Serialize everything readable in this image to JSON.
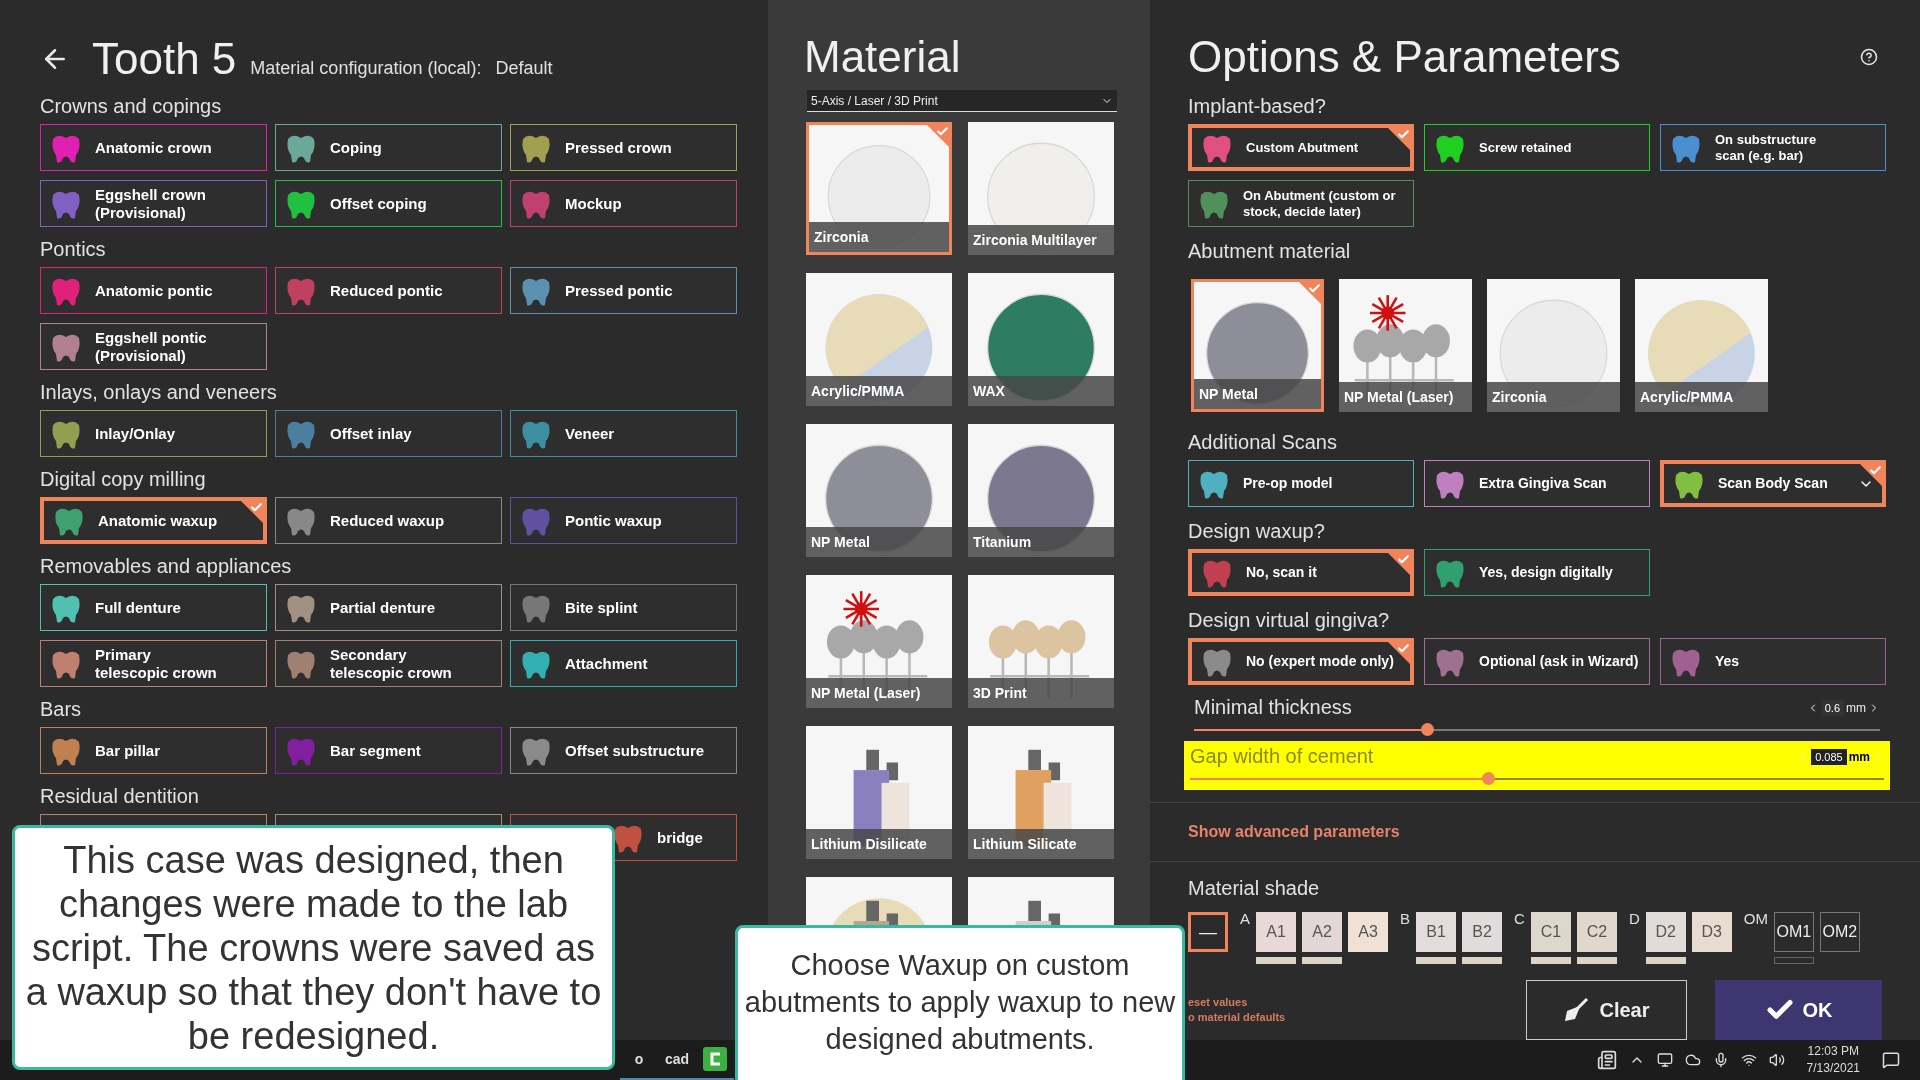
{
  "header": {
    "title": "Tooth 5",
    "config_label": "Material configuration (local):",
    "config_value": "Default"
  },
  "sections": [
    {
      "title": "Crowns and copings",
      "items": [
        {
          "label": "Anatomic crown",
          "color": "#e020b0",
          "selected": false
        },
        {
          "label": "Coping",
          "color": "#6aa89a",
          "selected": false
        },
        {
          "label": "Pressed crown",
          "color": "#a0a050",
          "selected": false
        },
        {
          "label": "Eggshell crown\n(Provisional)",
          "color": "#8060c0",
          "selected": false
        },
        {
          "label": "Offset coping",
          "color": "#20c040",
          "selected": false
        },
        {
          "label": "Mockup",
          "color": "#c04070",
          "selected": false
        }
      ]
    },
    {
      "title": "Pontics",
      "items": [
        {
          "label": "Anatomic pontic",
          "color": "#e0207a",
          "selected": false
        },
        {
          "label": "Reduced pontic",
          "color": "#c04060",
          "selected": false
        },
        {
          "label": "Pressed pontic",
          "color": "#5a90b0",
          "selected": false
        },
        {
          "label": "Eggshell pontic\n(Provisional)",
          "color": "#b08090",
          "selected": false
        }
      ]
    },
    {
      "title": "Inlays, onlays and veneers",
      "items": [
        {
          "label": "Inlay/Onlay",
          "color": "#90a050",
          "selected": false
        },
        {
          "label": "Offset inlay",
          "color": "#4a7fa0",
          "selected": false
        },
        {
          "label": "Veneer",
          "color": "#3a8fa0",
          "selected": false
        }
      ]
    },
    {
      "title": "Digital copy milling",
      "items": [
        {
          "label": "Anatomic waxup",
          "color": "#40a070",
          "selected": true
        },
        {
          "label": "Reduced waxup",
          "color": "#888888",
          "selected": false
        },
        {
          "label": "Pontic waxup",
          "color": "#6050a0",
          "selected": false
        }
      ]
    },
    {
      "title": "Removables and appliances",
      "items": [
        {
          "label": "Full denture",
          "color": "#50c0b0",
          "selected": false
        },
        {
          "label": "Partial denture",
          "color": "#a09080",
          "selected": false
        },
        {
          "label": "Bite splint",
          "color": "#777777",
          "selected": false
        },
        {
          "label": "Primary\ntelescopic crown",
          "color": "#c08070",
          "selected": false
        },
        {
          "label": "Secondary\ntelescopic crown",
          "color": "#a08070",
          "selected": false
        },
        {
          "label": "Attachment",
          "color": "#30b0b0",
          "selected": false
        }
      ]
    },
    {
      "title": "Bars",
      "items": [
        {
          "label": "Bar pillar",
          "color": "#c08050",
          "selected": false
        },
        {
          "label": "Bar segment",
          "color": "#8020a0",
          "selected": false
        },
        {
          "label": "Offset substructure",
          "color": "#8a8a8a",
          "selected": false
        }
      ]
    },
    {
      "title": "Residual dentition",
      "items": [
        {
          "color": "#c08060"
        },
        {
          "color": "#a09070"
        },
        {
          "label": "bridge",
          "color": "#c05040",
          "selected": false
        }
      ]
    }
  ],
  "material": {
    "title": "Material",
    "dropdown": "5-Axis / Laser / 3D Print",
    "tiles": [
      {
        "label": "Zirconia",
        "kind": "disc",
        "color": "#ececec",
        "selected": true
      },
      {
        "label": "Zirconia Multilayer",
        "kind": "disc",
        "color": "#f0efec",
        "selected": false
      },
      {
        "label": "Acrylic/PMMA",
        "kind": "split-disc",
        "color": "#e8dcb8",
        "selected": false
      },
      {
        "label": "WAX",
        "kind": "disc",
        "color": "#2e7d62",
        "selected": false
      },
      {
        "label": "NP Metal",
        "kind": "disc",
        "color": "#8e8e98",
        "selected": false
      },
      {
        "label": "Titanium",
        "kind": "disc",
        "color": "#7c7890",
        "selected": false
      },
      {
        "label": "NP Metal (Laser)",
        "kind": "laser-print",
        "color": "#a8a8a8",
        "selected": false
      },
      {
        "label": "3D Print",
        "kind": "print",
        "color": "#dcc4a0",
        "selected": false
      },
      {
        "label": "Lithium Disilicate",
        "kind": "block",
        "color": "#8a80c0",
        "selected": false
      },
      {
        "label": "Lithium Silicate",
        "kind": "block",
        "color": "#e0a060",
        "selected": false
      },
      {
        "kind": "block-disc",
        "selected": false
      },
      {
        "kind": "block",
        "selected": false
      }
    ]
  },
  "options": {
    "title": "Options & Parameters",
    "groups": [
      {
        "title": "Implant-based?",
        "items": [
          {
            "label": "Custom Abutment",
            "color": "#e05080",
            "selected": true
          },
          {
            "label": "Screw retained",
            "color": "#20d020",
            "selected": false
          },
          {
            "label": "On substructure\nscan (e.g. bar)",
            "color": "#4a90d0",
            "selected": false
          },
          {
            "label": "On Abutment (custom or\nstock, decide later)",
            "color": "#50905a",
            "selected": false
          }
        ]
      }
    ],
    "abutment": {
      "title": "Abutment material",
      "tiles": [
        {
          "label": "NP Metal",
          "kind": "disc",
          "color": "#8e8e98",
          "selected": true
        },
        {
          "label": "NP Metal (Laser)",
          "kind": "laser-print",
          "color": "#a8a8a8",
          "selected": false
        },
        {
          "label": "Zirconia",
          "kind": "disc",
          "color": "#ececec",
          "selected": false
        },
        {
          "label": "Acrylic/PMMA",
          "kind": "split-disc",
          "color": "#e8dcb8",
          "selected": false
        }
      ]
    },
    "groups2": [
      {
        "title": "Additional Scans",
        "items": [
          {
            "label": "Pre-op model",
            "color": "#50b0c0",
            "selected": false
          },
          {
            "label": "Extra Gingiva Scan",
            "color": "#c080c0",
            "selected": false
          },
          {
            "label": "Scan Body Scan",
            "color": "#80c040",
            "selected": true,
            "dropdown": true
          }
        ]
      },
      {
        "title": "Design waxup?",
        "items": [
          {
            "label": "No, scan it",
            "color": "#c04050",
            "selected": true
          },
          {
            "label": "Yes, design digitally",
            "color": "#30a070",
            "selected": false
          }
        ]
      },
      {
        "title": "Design virtual gingiva?",
        "items": [
          {
            "label": "No (expert mode only)",
            "color": "#8a8a8a",
            "selected": true
          },
          {
            "label": "Optional (ask in Wizard)",
            "color": "#a07090",
            "selected": false
          },
          {
            "label": "Yes",
            "color": "#a06090",
            "selected": false
          }
        ]
      }
    ],
    "sliders": [
      {
        "label": "Minimal thickness",
        "value": "0.6",
        "unit": "mm",
        "level": 0.34,
        "highlighted": false
      },
      {
        "label": "Gap width of cement",
        "value": "0.085",
        "unit": "mm",
        "level": 0.43,
        "highlighted": true
      }
    ],
    "advanced_link": "Show advanced parameters",
    "shade": {
      "title": "Material shade",
      "none": {
        "label": "—",
        "selected": true
      },
      "groups": [
        {
          "letter": "A",
          "kind": "solid",
          "chips": [
            {
              "label": "A1",
              "color": "#e8d8d8",
              "underline": true,
              "selected": false
            },
            {
              "label": "A2",
              "color": "#e2d6d6",
              "underline": true,
              "selected": false
            },
            {
              "label": "A3",
              "color": "#efe2d4",
              "underline": false,
              "selected": false
            }
          ]
        },
        {
          "letter": "B",
          "kind": "solid",
          "chips": [
            {
              "label": "B1",
              "color": "#e4dcdc",
              "underline": true,
              "selected": false
            },
            {
              "label": "B2",
              "color": "#e0dcdc",
              "underline": true,
              "selected": false
            }
          ]
        },
        {
          "letter": "C",
          "kind": "solid",
          "chips": [
            {
              "label": "C1",
              "color": "#ddd8cc",
              "underline": true,
              "selected": false
            },
            {
              "label": "C2",
              "color": "#e0d8cc",
              "underline": true,
              "selected": false
            }
          ]
        },
        {
          "letter": "D",
          "kind": "solid",
          "chips": [
            {
              "label": "D2",
              "color": "#e2dcd8",
              "underline": true,
              "selected": false
            },
            {
              "label": "D3",
              "color": "#e8dcd0",
              "underline": false,
              "selected": false
            }
          ]
        },
        {
          "letter": "OM",
          "kind": "outline",
          "chips": [
            {
              "label": "OM1",
              "color": "#2b2b2b",
              "underline": true,
              "selected": false
            },
            {
              "label": "OM2",
              "color": "#2b2b2b",
              "underline": false,
              "selected": false
            }
          ]
        }
      ]
    },
    "reset_link": "eset values\no material defaults",
    "buttons": [
      {
        "label": "Clear",
        "kind": "clear"
      },
      {
        "label": "OK",
        "kind": "ok"
      }
    ]
  },
  "callouts": [
    "This case was designed, then changes were made to the lab script. The crowns were saved as a waxup so that they don't have to be redesigned.",
    "Choose Waxup on custom abutments to apply waxup to new designed abutments."
  ],
  "taskbar": {
    "apps": [
      {
        "kind": "text-tile",
        "label": "o"
      },
      {
        "kind": "text-tile",
        "label": "cad"
      },
      {
        "kind": "logo-tile"
      }
    ],
    "time": "12:03 PM",
    "date": "7/13/2021"
  }
}
